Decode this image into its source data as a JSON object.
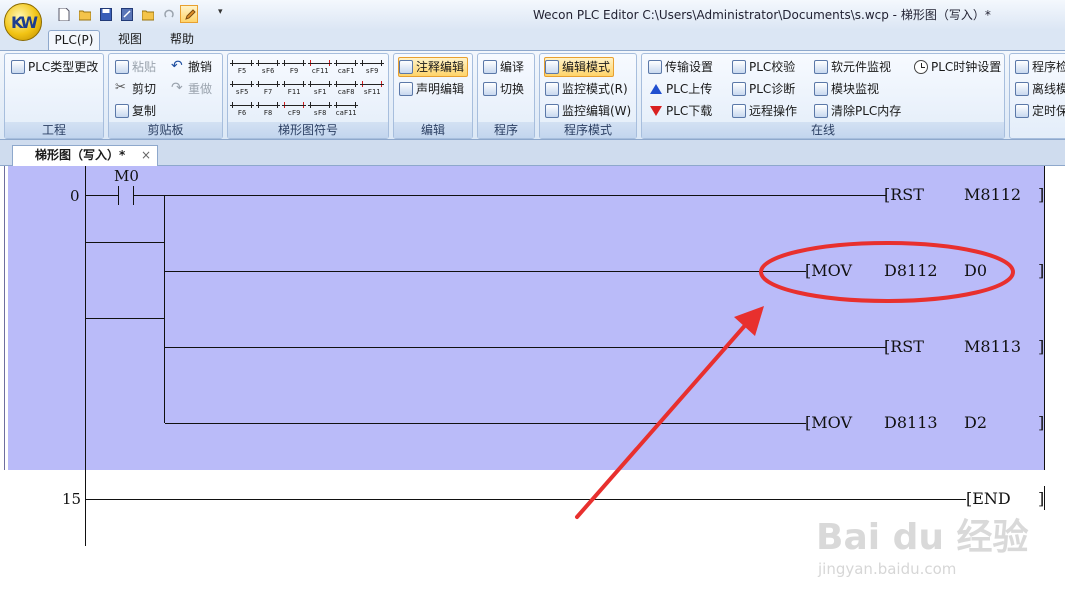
{
  "app": {
    "window_title": "Wecon PLC Editor  C:\\Users\\Administrator\\Documents\\s.wcp   - 梯形图（写入）*",
    "orb_text": "KW"
  },
  "ribbon_tabs": [
    "PLC(P)",
    "视图",
    "帮助"
  ],
  "groups": {
    "project": {
      "label": "工程",
      "plc_type_change": "PLC类型更改"
    },
    "clipboard": {
      "label": "剪贴板",
      "paste": "粘贴",
      "cut": "剪切",
      "copy": "复制",
      "undo": "撤销",
      "redo": "重做"
    },
    "ladder_symbols": {
      "label": "梯形图符号",
      "symbols": [
        "F5",
        "sF6",
        "F9",
        "cF11",
        "caF1",
        "sF9",
        "sF5",
        "F7",
        "F11",
        "sF1",
        "caF8",
        "sF11",
        "F6",
        "F8",
        "cF9",
        "sF8",
        "caF11"
      ]
    },
    "edit": {
      "label": "编辑",
      "comment_edit": "注释编辑",
      "statement_edit": "声明编辑"
    },
    "program": {
      "label": "程序",
      "compile": "编译",
      "switch": "切换"
    },
    "program_mode": {
      "label": "程序模式",
      "edit_mode": "编辑模式",
      "monitor_mode": "监控模式(R)",
      "monitor_edit": "监控编辑(W)"
    },
    "online": {
      "label": "在线",
      "transfer_settings": "传输设置",
      "plc_upload": "PLC上传",
      "plc_download": "PLC下载",
      "plc_verify": "PLC校验",
      "plc_diagnose": "PLC诊断",
      "remote_operation": "远程操作",
      "device_monitor": "软元件监视",
      "module_monitor": "模块监视",
      "clear_plc_memory": "清除PLC内存",
      "plc_clock_settings": "PLC时钟设置"
    },
    "extra": {
      "item1": "程序检",
      "item2": "离线模",
      "item3": "定时保"
    }
  },
  "doc_tab": {
    "label": "梯形图（写入）*",
    "close": "×"
  },
  "ladder": {
    "rung0": {
      "step": "0",
      "contact": "M0",
      "instructions": [
        {
          "op": "[RST",
          "arg1": "M8112",
          "arg2": ""
        },
        {
          "op": "[MOV",
          "arg1": "D8112",
          "arg2": "D0"
        },
        {
          "op": "[RST",
          "arg1": "M8113",
          "arg2": ""
        },
        {
          "op": "[MOV",
          "arg1": "D8113",
          "arg2": "D2"
        }
      ],
      "closing_bracket": "]"
    },
    "rung1": {
      "step": "15",
      "instruction": "[END",
      "closing_bracket": "]"
    }
  },
  "annotation": {
    "color": "#e8302e"
  },
  "watermark": {
    "logo": "Bai du 经验",
    "url": "jingyan.baidu.com"
  },
  "colors": {
    "rung_highlight": "#babbf9",
    "ribbon_bg": "#dce8f6",
    "selected_btn": "#ffd46a"
  }
}
